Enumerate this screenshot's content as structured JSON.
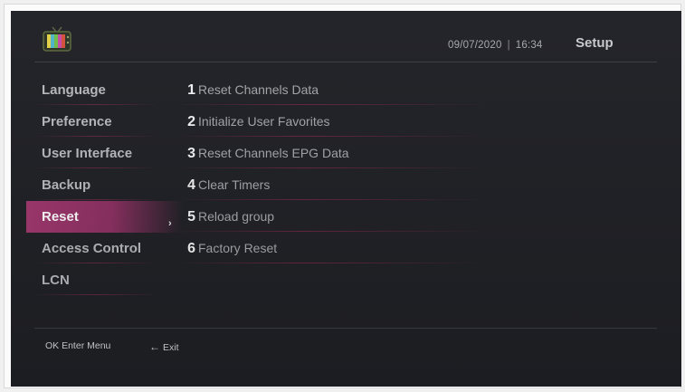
{
  "header": {
    "date": "09/07/2020",
    "separator": "|",
    "time": "16:34",
    "title": "Setup",
    "logo_icon": "tv-icon"
  },
  "menu": {
    "items": [
      {
        "label": "Language"
      },
      {
        "label": "Preference"
      },
      {
        "label": "User Interface"
      },
      {
        "label": "Backup"
      },
      {
        "label": "Reset"
      },
      {
        "label": "Access Control"
      },
      {
        "label": "LCN"
      }
    ],
    "active_index": 4,
    "active_indicator": "›"
  },
  "options": [
    {
      "num": "1",
      "label": "Reset Channels Data"
    },
    {
      "num": "2",
      "label": "Initialize User Favorites"
    },
    {
      "num": "3",
      "label": "Reset Channels EPG Data"
    },
    {
      "num": "4",
      "label": "Clear Timers"
    },
    {
      "num": "5",
      "label": "Reload group"
    },
    {
      "num": "6",
      "label": "Factory Reset"
    }
  ],
  "footer": {
    "ok_label": "OK Enter Menu",
    "exit_arrow": "←",
    "exit_label": "Exit"
  },
  "colors": {
    "background": "#202126",
    "accent": "#a2386f"
  }
}
